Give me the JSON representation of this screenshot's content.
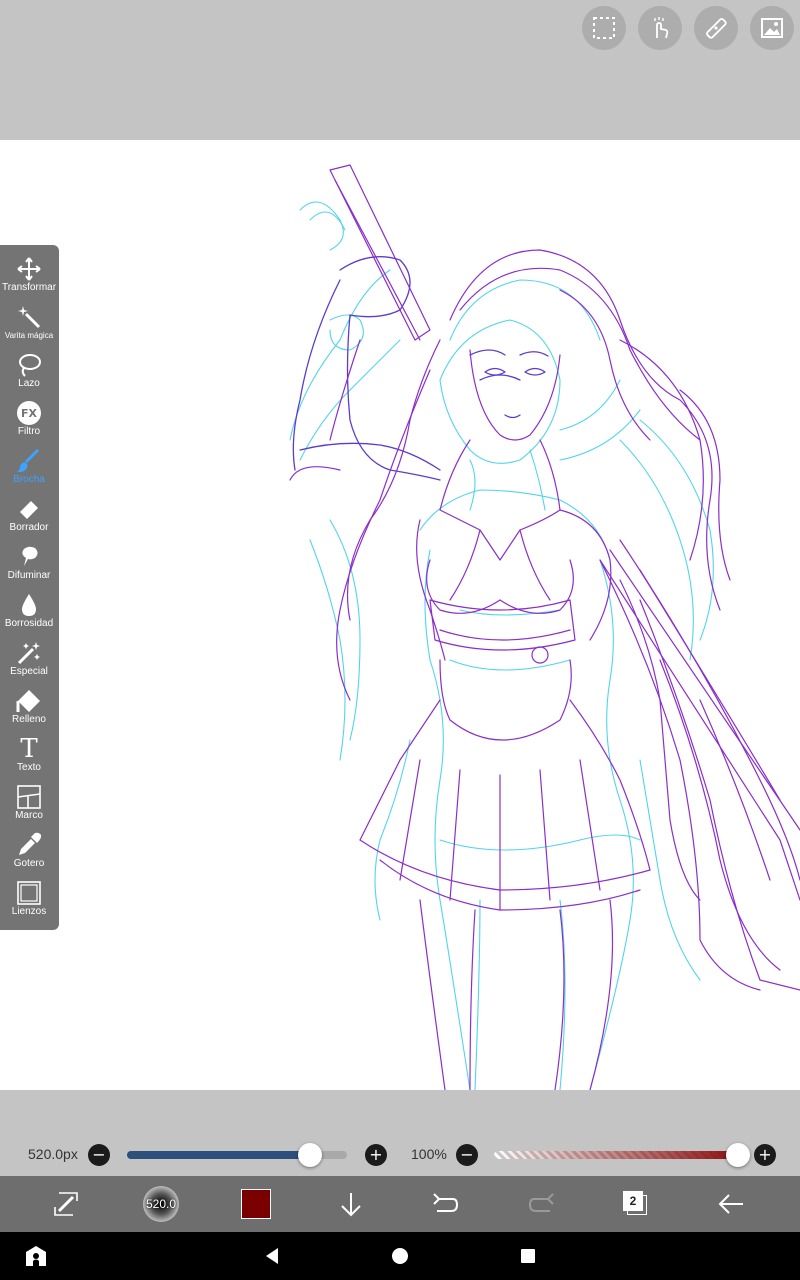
{
  "top_buttons": [
    {
      "name": "selection-icon"
    },
    {
      "name": "touch-icon"
    },
    {
      "name": "ruler-icon"
    },
    {
      "name": "image-icon"
    }
  ],
  "tools": [
    {
      "label": "Transformar",
      "icon": "move-icon"
    },
    {
      "label": "Varita mágica",
      "icon": "magic-wand-icon"
    },
    {
      "label": "Lazo",
      "icon": "lasso-icon"
    },
    {
      "label": "Filtro",
      "icon": "fx-icon",
      "icon_text": "FX"
    },
    {
      "label": "Brocha",
      "icon": "brush-icon",
      "active": true
    },
    {
      "label": "Borrador",
      "icon": "eraser-icon"
    },
    {
      "label": "Difuminar",
      "icon": "smudge-icon"
    },
    {
      "label": "Borrosidad",
      "icon": "blur-icon"
    },
    {
      "label": "Especial",
      "icon": "special-icon"
    },
    {
      "label": "Relleno",
      "icon": "fill-icon"
    },
    {
      "label": "Texto",
      "icon": "text-icon",
      "icon_text": "T"
    },
    {
      "label": "Marco",
      "icon": "frame-icon"
    },
    {
      "label": "Gotero",
      "icon": "eyedropper-icon"
    },
    {
      "label": "Lienzos",
      "icon": "canvas-icon"
    }
  ],
  "brush_size": {
    "label": "520.0px",
    "minus": "−",
    "plus": "+",
    "level": 0.83
  },
  "opacity": {
    "label": "100%",
    "minus": "−",
    "plus": "+",
    "level": 1.0
  },
  "action_bar": {
    "brush_preview_value": "520.0",
    "current_color": "#7a0000",
    "layer_count": "2"
  },
  "colors": {
    "accent": "#3da3ff",
    "size_track": "#2c4f7c",
    "sketch_cyan": "#3fd0e8",
    "sketch_purple": "#8a2fc9",
    "sketch_violet": "#5b3ccf"
  }
}
